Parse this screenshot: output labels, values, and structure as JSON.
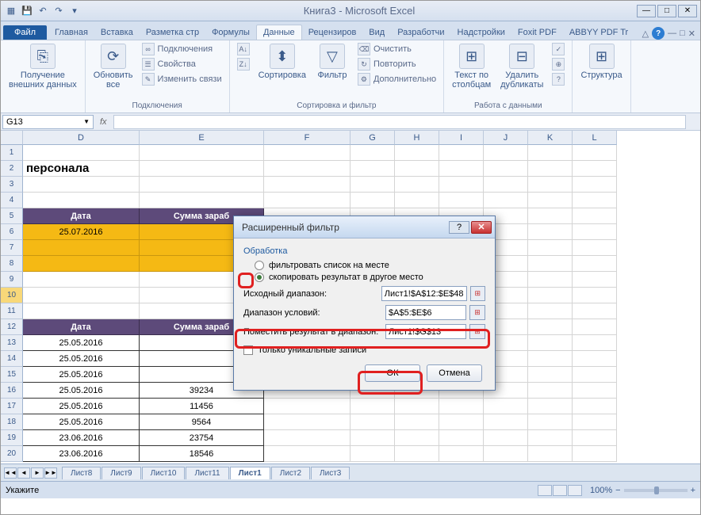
{
  "title": "Книга3  -  Microsoft Excel",
  "tabs": [
    "Главная",
    "Вставка",
    "Разметка стр",
    "Формулы",
    "Данные",
    "Рецензиров",
    "Вид",
    "Разработчи",
    "Надстройки",
    "Foxit PDF",
    "ABBYY PDF Tr"
  ],
  "active_tab": 4,
  "ribbon": {
    "g1": {
      "label": "",
      "btn": "Получение\nвнешних данных"
    },
    "g2": {
      "label": "Подключения",
      "btn": "Обновить\nвсе",
      "s": [
        "Подключения",
        "Свойства",
        "Изменить связи"
      ]
    },
    "g3": {
      "label": "Сортировка и фильтр",
      "sort": "Сортировка",
      "filter": "Фильтр",
      "s": [
        "Очистить",
        "Повторить",
        "Дополнительно"
      ]
    },
    "g4": {
      "label": "Работа с данными",
      "btn1": "Текст по\nстолбцам",
      "btn2": "Удалить\nдубликаты"
    },
    "g5": {
      "label": "",
      "btn": "Структура"
    }
  },
  "namebox": "G13",
  "fx": "fx",
  "cols": {
    "D": 147,
    "E": 157,
    "F": 109,
    "G": 56,
    "H": 56,
    "I": 56,
    "J": 56,
    "K": 56,
    "L": 56
  },
  "rows": [
    1,
    2,
    3,
    4,
    5,
    6,
    7,
    8,
    9,
    10,
    11,
    12,
    13,
    14,
    15,
    16,
    17,
    18,
    19,
    20
  ],
  "cells": {
    "r2": {
      "D": "персонала"
    },
    "r5": {
      "D": "Дата",
      "E": "Сумма зараб"
    },
    "r6": {
      "D": "25.07.2016"
    },
    "r12": {
      "D": "Дата",
      "E": "Сумма зараб"
    },
    "r13": {
      "D": "25.05.2016"
    },
    "r14": {
      "D": "25.05.2016"
    },
    "r15": {
      "D": "25.05.2016"
    },
    "r16": {
      "D": "25.05.2016",
      "E": "39234"
    },
    "r17": {
      "D": "25.05.2016",
      "E": "11456"
    },
    "r18": {
      "D": "25.05.2016",
      "E": "9564"
    },
    "r19": {
      "D": "23.06.2016",
      "E": "23754"
    },
    "r20": {
      "D": "23.06.2016",
      "E": "18546"
    }
  },
  "sheets": [
    "Лист8",
    "Лист9",
    "Лист10",
    "Лист11",
    "Лист1",
    "Лист2",
    "Лист3"
  ],
  "active_sheet": 4,
  "status": "Укажите",
  "zoom": "100%",
  "dialog": {
    "title": "Расширенный фильтр",
    "section": "Обработка",
    "radio1": "фильтровать список на месте",
    "radio2": "скопировать результат в другое место",
    "label1": "Исходный диапазон:",
    "val1": "Лист1!$A$12:$E$48",
    "label2": "Диапазон условий:",
    "val2": "$A$5:$E$6",
    "label3": "Поместить результат в диапазон:",
    "val3": "Лист1!$G$13",
    "check": "Только уникальные записи",
    "ok": "ОК",
    "cancel": "Отмена"
  }
}
